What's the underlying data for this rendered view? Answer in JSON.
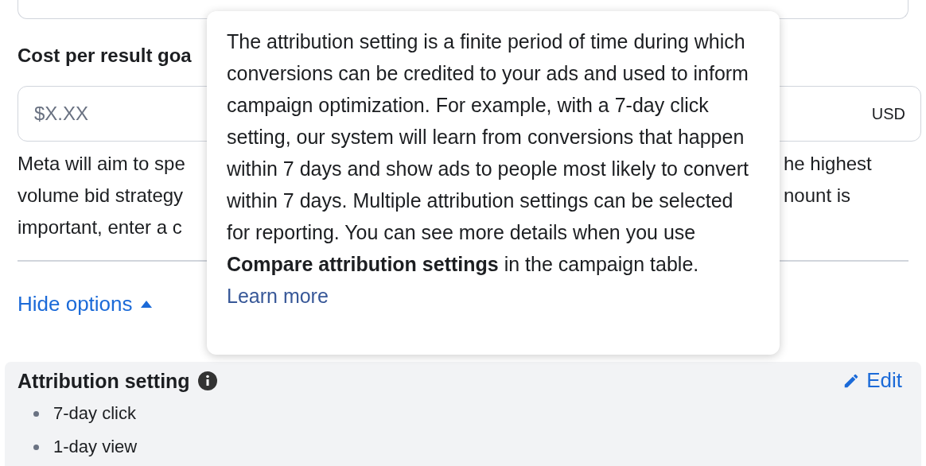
{
  "cost_goal": {
    "label": "Cost per result goa",
    "placeholder": "$X.XX",
    "currency": "USD"
  },
  "description": {
    "left_lines": [
      "Meta will aim to spe",
      "volume bid strategy",
      "important, enter a c"
    ],
    "right_lines": [
      "he highest",
      "nount is"
    ]
  },
  "hide_options": {
    "label": "Hide options",
    "expanded": true
  },
  "attribution": {
    "title": "Attribution setting",
    "edit": "Edit",
    "items": [
      "7-day click",
      "1-day view"
    ]
  },
  "tooltip": {
    "text": "The attribution setting is a finite period of time during which conversions can be credited to your ads and used to inform campaign optimization. For example, with a 7-day click setting, our system will learn from conversions that happen within 7 days and show ads to people most likely to convert within 7 days. Multiple attribution settings can be selected for reporting. You can see more details when you use **Compare attribution settings** in the campaign table.",
    "link": "Learn more"
  }
}
